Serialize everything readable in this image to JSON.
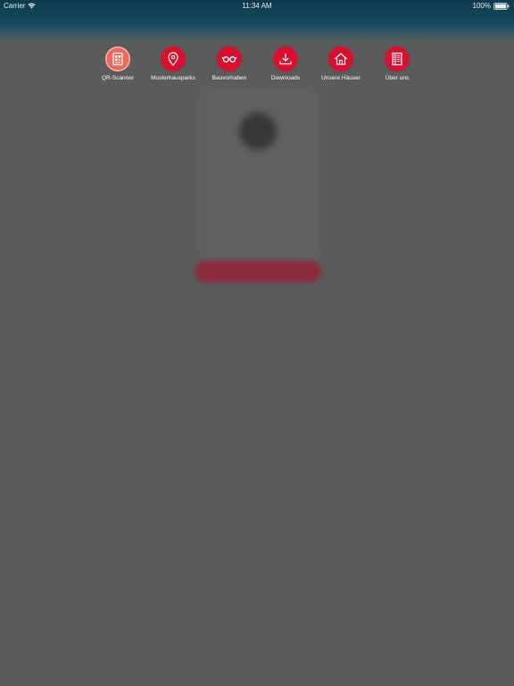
{
  "status_bar": {
    "carrier": "Carrier",
    "time": "11:34 AM",
    "battery": "100%"
  },
  "menu": {
    "items": [
      {
        "label": "QR-Scanner",
        "icon": "qr-scanner-icon",
        "active": true
      },
      {
        "label": "Musterhausparks",
        "icon": "location-pin-icon",
        "active": false
      },
      {
        "label": "Bauvorhaben",
        "icon": "glasses-icon",
        "active": false
      },
      {
        "label": "Downloads",
        "icon": "download-icon",
        "active": false
      },
      {
        "label": "Unsere Häuser",
        "icon": "house-icon",
        "active": false
      },
      {
        "label": "Über uns",
        "icon": "document-list-icon",
        "active": false
      }
    ]
  },
  "colors": {
    "accent": "#d9102f",
    "active_accent": "#ea6a5e",
    "overlay": "#5b5b5b",
    "header": "#0c3b4c"
  }
}
